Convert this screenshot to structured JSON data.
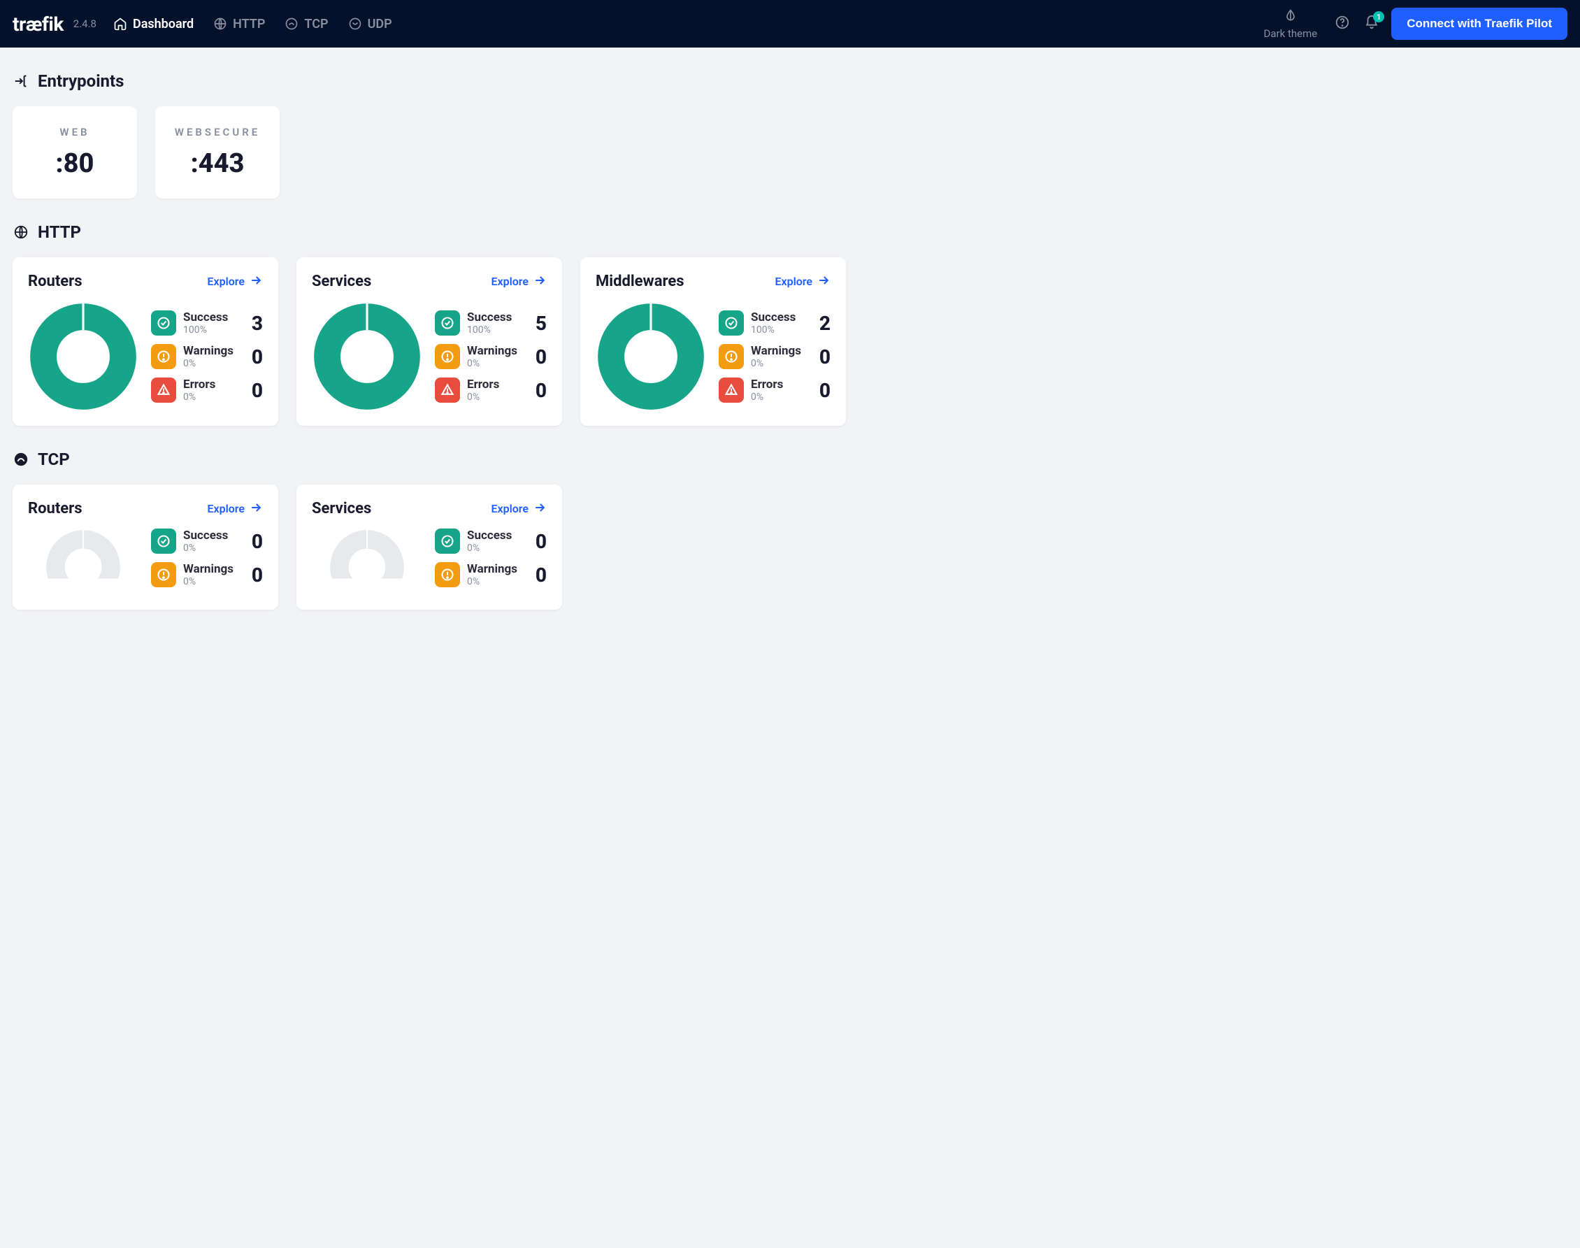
{
  "header": {
    "logo_text": "træfik",
    "version": "2.4.8",
    "nav": {
      "dashboard": "Dashboard",
      "http": "HTTP",
      "tcp": "TCP",
      "udp": "UDP"
    },
    "dark_theme": "Dark theme",
    "notifications_count": "1",
    "pilot_button": "Connect with Traefik Pilot"
  },
  "sections": {
    "entrypoints_title": "Entrypoints",
    "http_title": "HTTP",
    "tcp_title": "TCP"
  },
  "entrypoints": [
    {
      "name": "WEB",
      "port": ":80"
    },
    {
      "name": "WEBSECURE",
      "port": ":443"
    }
  ],
  "stat_labels": {
    "success": "Success",
    "warnings": "Warnings",
    "errors": "Errors",
    "explore": "Explore"
  },
  "http_cards": {
    "routers": {
      "title": "Routers",
      "success_pct": "100%",
      "success_count": "3",
      "warnings_pct": "0%",
      "warnings_count": "0",
      "errors_pct": "0%",
      "errors_count": "0"
    },
    "services": {
      "title": "Services",
      "success_pct": "100%",
      "success_count": "5",
      "warnings_pct": "0%",
      "warnings_count": "0",
      "errors_pct": "0%",
      "errors_count": "0"
    },
    "middlewares": {
      "title": "Middlewares",
      "success_pct": "100%",
      "success_count": "2",
      "warnings_pct": "0%",
      "warnings_count": "0",
      "errors_pct": "0%",
      "errors_count": "0"
    }
  },
  "tcp_cards": {
    "routers": {
      "title": "Routers",
      "success_pct": "0%",
      "success_count": "0",
      "warnings_pct": "0%",
      "warnings_count": "0"
    },
    "services": {
      "title": "Services",
      "success_pct": "0%",
      "success_count": "0",
      "warnings_pct": "0%",
      "warnings_count": "0"
    }
  },
  "chart_data": [
    {
      "type": "pie",
      "title": "HTTP Routers",
      "categories": [
        "Success",
        "Warnings",
        "Errors"
      ],
      "values": [
        3,
        0,
        0
      ]
    },
    {
      "type": "pie",
      "title": "HTTP Services",
      "categories": [
        "Success",
        "Warnings",
        "Errors"
      ],
      "values": [
        5,
        0,
        0
      ]
    },
    {
      "type": "pie",
      "title": "HTTP Middlewares",
      "categories": [
        "Success",
        "Warnings",
        "Errors"
      ],
      "values": [
        2,
        0,
        0
      ]
    },
    {
      "type": "pie",
      "title": "TCP Routers",
      "categories": [
        "Success",
        "Warnings",
        "Errors"
      ],
      "values": [
        0,
        0,
        0
      ]
    },
    {
      "type": "pie",
      "title": "TCP Services",
      "categories": [
        "Success",
        "Warnings",
        "Errors"
      ],
      "values": [
        0,
        0,
        0
      ]
    }
  ]
}
